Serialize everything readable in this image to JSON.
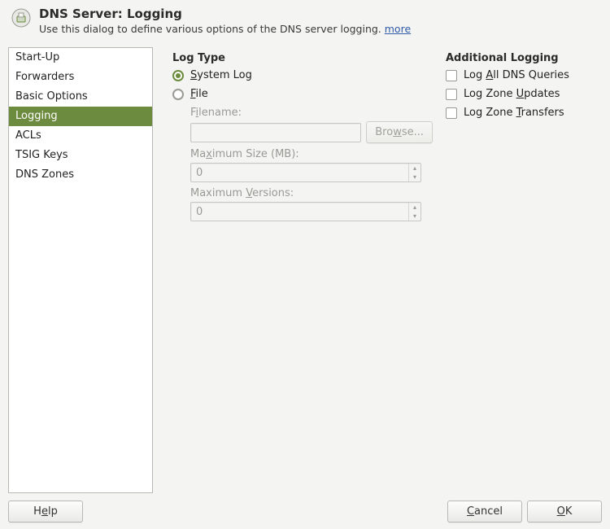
{
  "header": {
    "title": "DNS Server: Logging",
    "subtitle": "Use this dialog to define various options of the DNS server logging. ",
    "more_label": "more"
  },
  "sidebar": {
    "items": [
      {
        "label": "Start-Up",
        "selected": false
      },
      {
        "label": "Forwarders",
        "selected": false
      },
      {
        "label": "Basic Options",
        "selected": false
      },
      {
        "label": "Logging",
        "selected": true
      },
      {
        "label": "ACLs",
        "selected": false
      },
      {
        "label": "TSIG Keys",
        "selected": false
      },
      {
        "label": "DNS Zones",
        "selected": false
      }
    ]
  },
  "logType": {
    "section": "Log Type",
    "system_pre": "",
    "system_u": "S",
    "system_post": "ystem Log",
    "file_pre": "",
    "file_u": "F",
    "file_post": "ile",
    "filename_pre": "F",
    "filename_u": "i",
    "filename_post": "lename:",
    "filename_value": "",
    "browse_pre": "Bro",
    "browse_u": "w",
    "browse_post": "se...",
    "maxsize_pre": "Ma",
    "maxsize_u": "x",
    "maxsize_post": "imum Size (MB):",
    "maxsize_value": "0",
    "maxver_pre": "Maximum ",
    "maxver_u": "V",
    "maxver_post": "ersions:",
    "maxver_value": "0"
  },
  "additional": {
    "section": "Additional Logging",
    "queries_pre": "Log ",
    "queries_u": "A",
    "queries_post": "ll DNS Queries",
    "updates_pre": "Log Zone ",
    "updates_u": "U",
    "updates_post": "pdates",
    "transfers_pre": "Log Zone ",
    "transfers_u": "T",
    "transfers_post": "ransfers"
  },
  "footer": {
    "help_pre": "H",
    "help_u": "e",
    "help_post": "lp",
    "cancel_pre": "",
    "cancel_u": "C",
    "cancel_post": "ancel",
    "ok_pre": "",
    "ok_u": "O",
    "ok_post": "K"
  }
}
